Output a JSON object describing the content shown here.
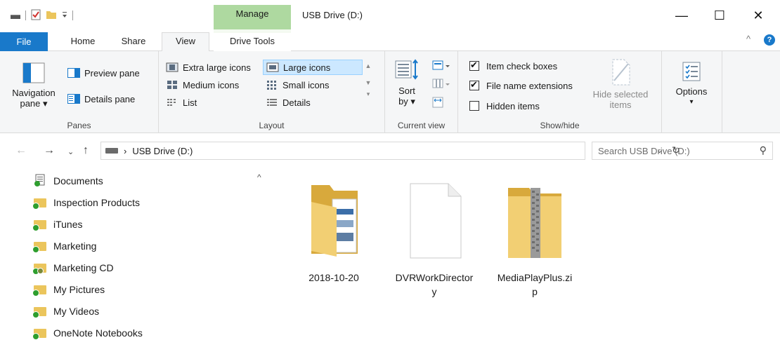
{
  "window": {
    "title": "USB Drive (D:)",
    "manage_tab": "Manage",
    "controls": {
      "minimize": "—",
      "maximize": "☐",
      "close": "✕"
    }
  },
  "tabs": {
    "file": "File",
    "home": "Home",
    "share": "Share",
    "view": "View",
    "drive_tools": "Drive Tools",
    "collapse": "^",
    "help": "?"
  },
  "ribbon": {
    "panes": {
      "label": "Panes",
      "navigation_pane": "Navigation",
      "navigation_pane_2": "pane ▾",
      "preview_pane": "Preview pane",
      "details_pane": "Details pane"
    },
    "layout": {
      "label": "Layout",
      "extra_large_icons": "Extra large icons",
      "large_icons": "Large icons",
      "medium_icons": "Medium icons",
      "small_icons": "Small icons",
      "list": "List",
      "details": "Details"
    },
    "current_view": {
      "label": "Current view",
      "sort_by": "Sort",
      "sort_by_2": "by ▾"
    },
    "show_hide": {
      "label": "Show/hide",
      "item_check_boxes": "Item check boxes",
      "item_check_boxes_checked": true,
      "file_name_extensions": "File name extensions",
      "file_name_extensions_checked": true,
      "hidden_items": "Hidden items",
      "hidden_items_checked": false,
      "hide_selected": "Hide selected",
      "hide_selected_2": "items"
    },
    "options": {
      "label": "Options",
      "arrow": "▾"
    }
  },
  "address": {
    "path_separator": "›",
    "location": "USB Drive (D:)",
    "search_placeholder": "Search USB Drive (D:)"
  },
  "nav_pane": {
    "items": [
      {
        "label": "Documents",
        "icon": "documents-icon"
      },
      {
        "label": "Inspection Products",
        "icon": "synced-folder-icon"
      },
      {
        "label": "iTunes",
        "icon": "synced-folder-icon"
      },
      {
        "label": "Marketing",
        "icon": "synced-folder-icon"
      },
      {
        "label": "Marketing CD",
        "icon": "shared-synced-folder-icon"
      },
      {
        "label": "My Pictures",
        "icon": "synced-folder-icon"
      },
      {
        "label": "My Videos",
        "icon": "synced-folder-icon"
      },
      {
        "label": "OneNote Notebooks",
        "icon": "synced-folder-icon"
      }
    ]
  },
  "files": [
    {
      "name": "2018-10-20",
      "type": "folder"
    },
    {
      "name": "DVRWorkDirector\ny",
      "type": "blank-file"
    },
    {
      "name": "MediaPlayPlus.zi\np",
      "type": "zip-folder"
    }
  ],
  "colors": {
    "file_tab": "#1979ca",
    "manage_tab": "#aed9a0",
    "selected_layout": "#cce8ff",
    "folder": "#ebc55c",
    "sync_badge": "#2e9e2e"
  }
}
